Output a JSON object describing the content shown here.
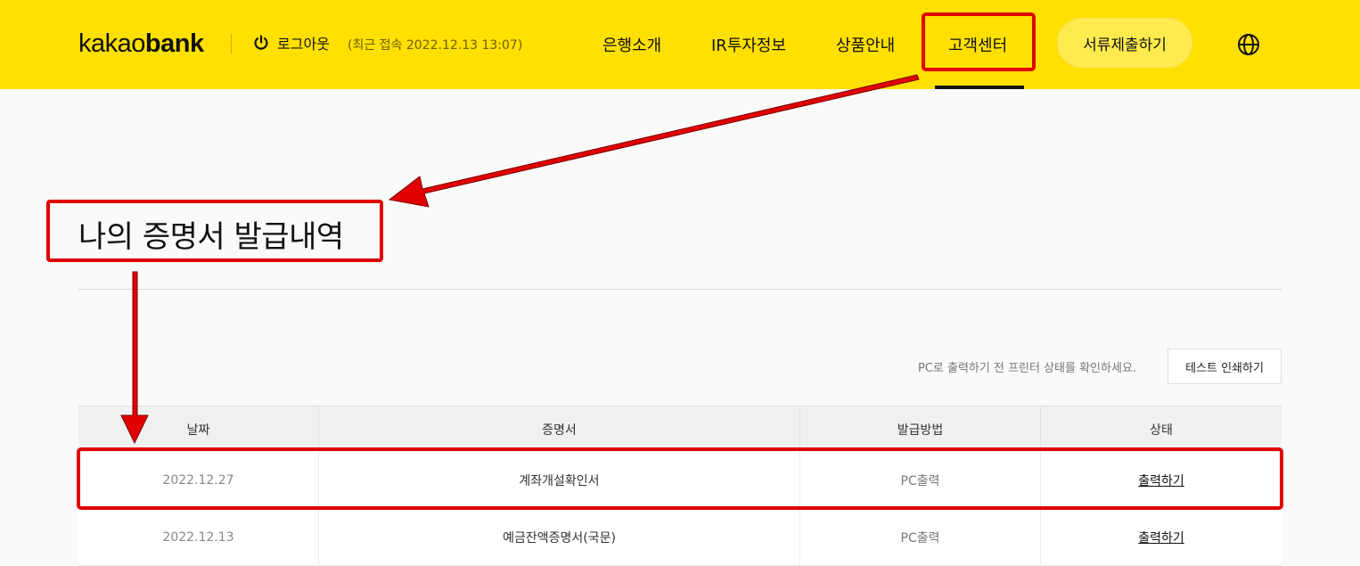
{
  "header": {
    "logo_light": "kakao",
    "logo_bold": "bank",
    "logout_label": "로그아웃",
    "last_login": "(최근 접속 2022.12.13 13:07)",
    "nav": [
      "은행소개",
      "IR투자정보",
      "상품안내",
      "고객센터"
    ],
    "active_nav": "고객센터",
    "submit_button": "서류제출하기",
    "icons": {
      "logout": "power-icon",
      "language": "globe-icon"
    },
    "brand_color": "#ffe000"
  },
  "main": {
    "title": "나의 증명서 발급내역",
    "print_hint": "PC로 출력하기 전 프린터 상태를 확인하세요.",
    "test_print_button": "테스트 인쇄하기",
    "table": {
      "columns": [
        "날짜",
        "증명서",
        "발급방법",
        "상태"
      ],
      "rows": [
        {
          "date": "2022.12.27",
          "certificate": "계좌개설확인서",
          "method": "PC출력",
          "status": "출력하기"
        },
        {
          "date": "2022.12.13",
          "certificate": "예금잔액증명서(국문)",
          "method": "PC출력",
          "status": "출력하기"
        }
      ]
    }
  },
  "annotation_color": "#e00000"
}
